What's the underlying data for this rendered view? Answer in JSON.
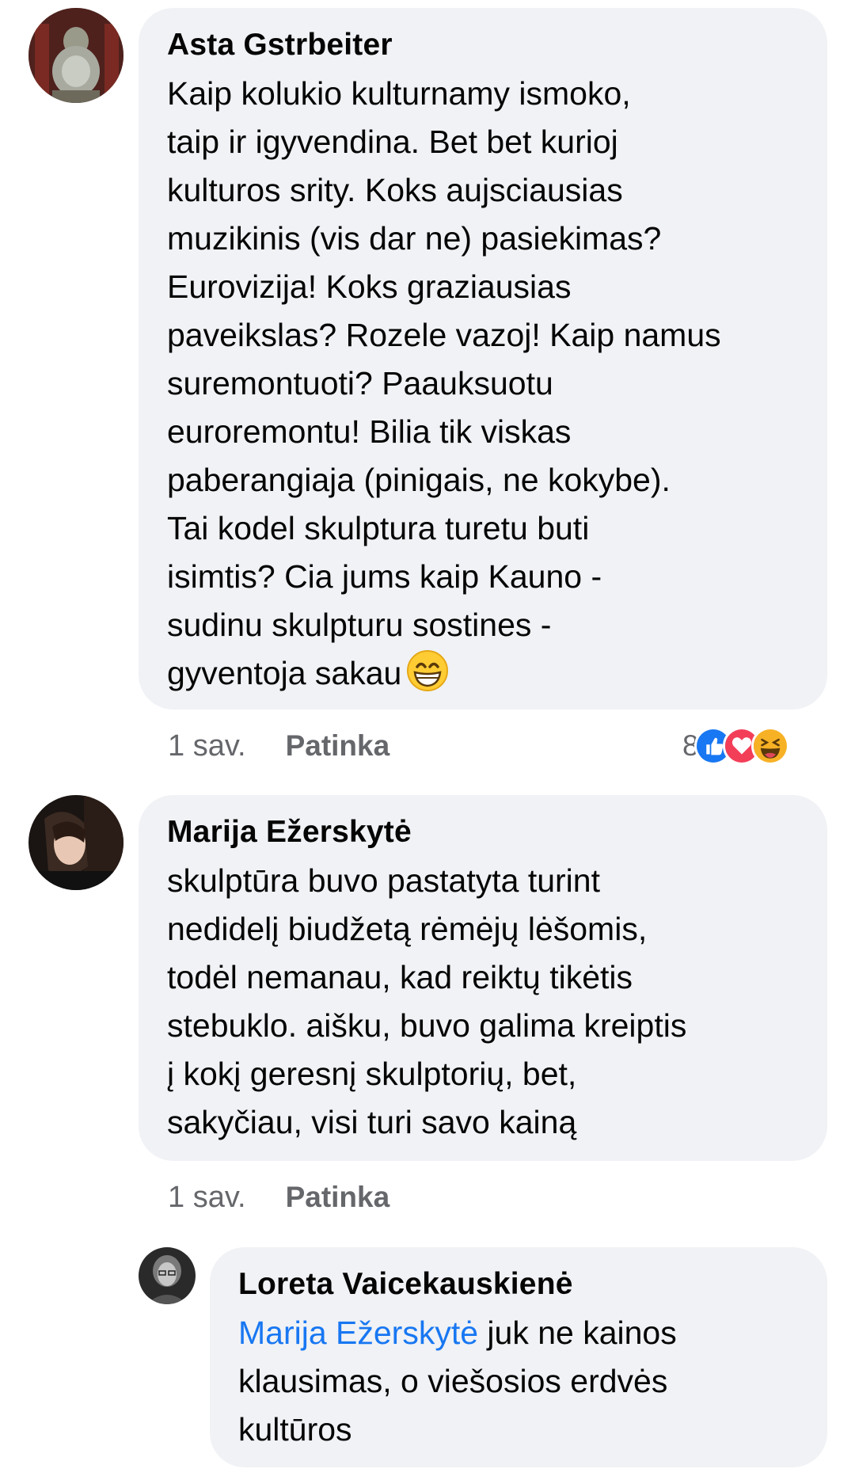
{
  "comments": [
    {
      "author": "Asta Gstrbeiter",
      "text": "Kaip kolukio kulturnamy ismoko,\ntaip ir igyvendina. Bet bet kurioj\nkulturos srity. Koks aujsciausias\nmuzikinis (vis dar ne) pasiekimas?\nEurovizija! Koks graziausias\npaveikslas? Rozele vazoj! Kaip namus\nsuremontuoti? Paauksuotu\neuroremontu! Bilia tik viskas\npaberangiaja (pinigais, ne kokybe).\nTai kodel skulptura turetu buti\nisimtis? Cia jums kaip Kauno -\nsudinu skulpturu sostines -\ngyventoja sakau",
      "emoji": "grinning-face-smiling-eyes",
      "time": "1 sav.",
      "like_label": "Patinka",
      "reaction_count": "8",
      "reactions": [
        "like",
        "love",
        "haha"
      ]
    },
    {
      "author": "Marija Ežerskytė",
      "text": "skulptūra buvo pastatyta turint\nnedidelį biudžetą rėmėjų lėšomis,\ntodėl nemanau, kad reiktų tikėtis\nstebuklo. aišku, buvo galima kreiptis\nį kokį geresnį skulptorių, bet,\nsakyčiau, visi turi savo kainą",
      "time": "1 sav.",
      "like_label": "Patinka"
    },
    {
      "author": "Loreta Vaicekauskienė",
      "mention": "Marija Ežerskytė",
      "text_line1": " juk ne kainos",
      "text_rest": "klausimas, o viešosios erdvės\nkultūros"
    }
  ],
  "colors": {
    "bubble_bg": "#f0f2f5",
    "secondary_text": "#65676b",
    "mention": "#1877f2",
    "like_blue": "#1877f2",
    "love_red": "#f33e58",
    "haha_yellow": "#f7b125"
  }
}
